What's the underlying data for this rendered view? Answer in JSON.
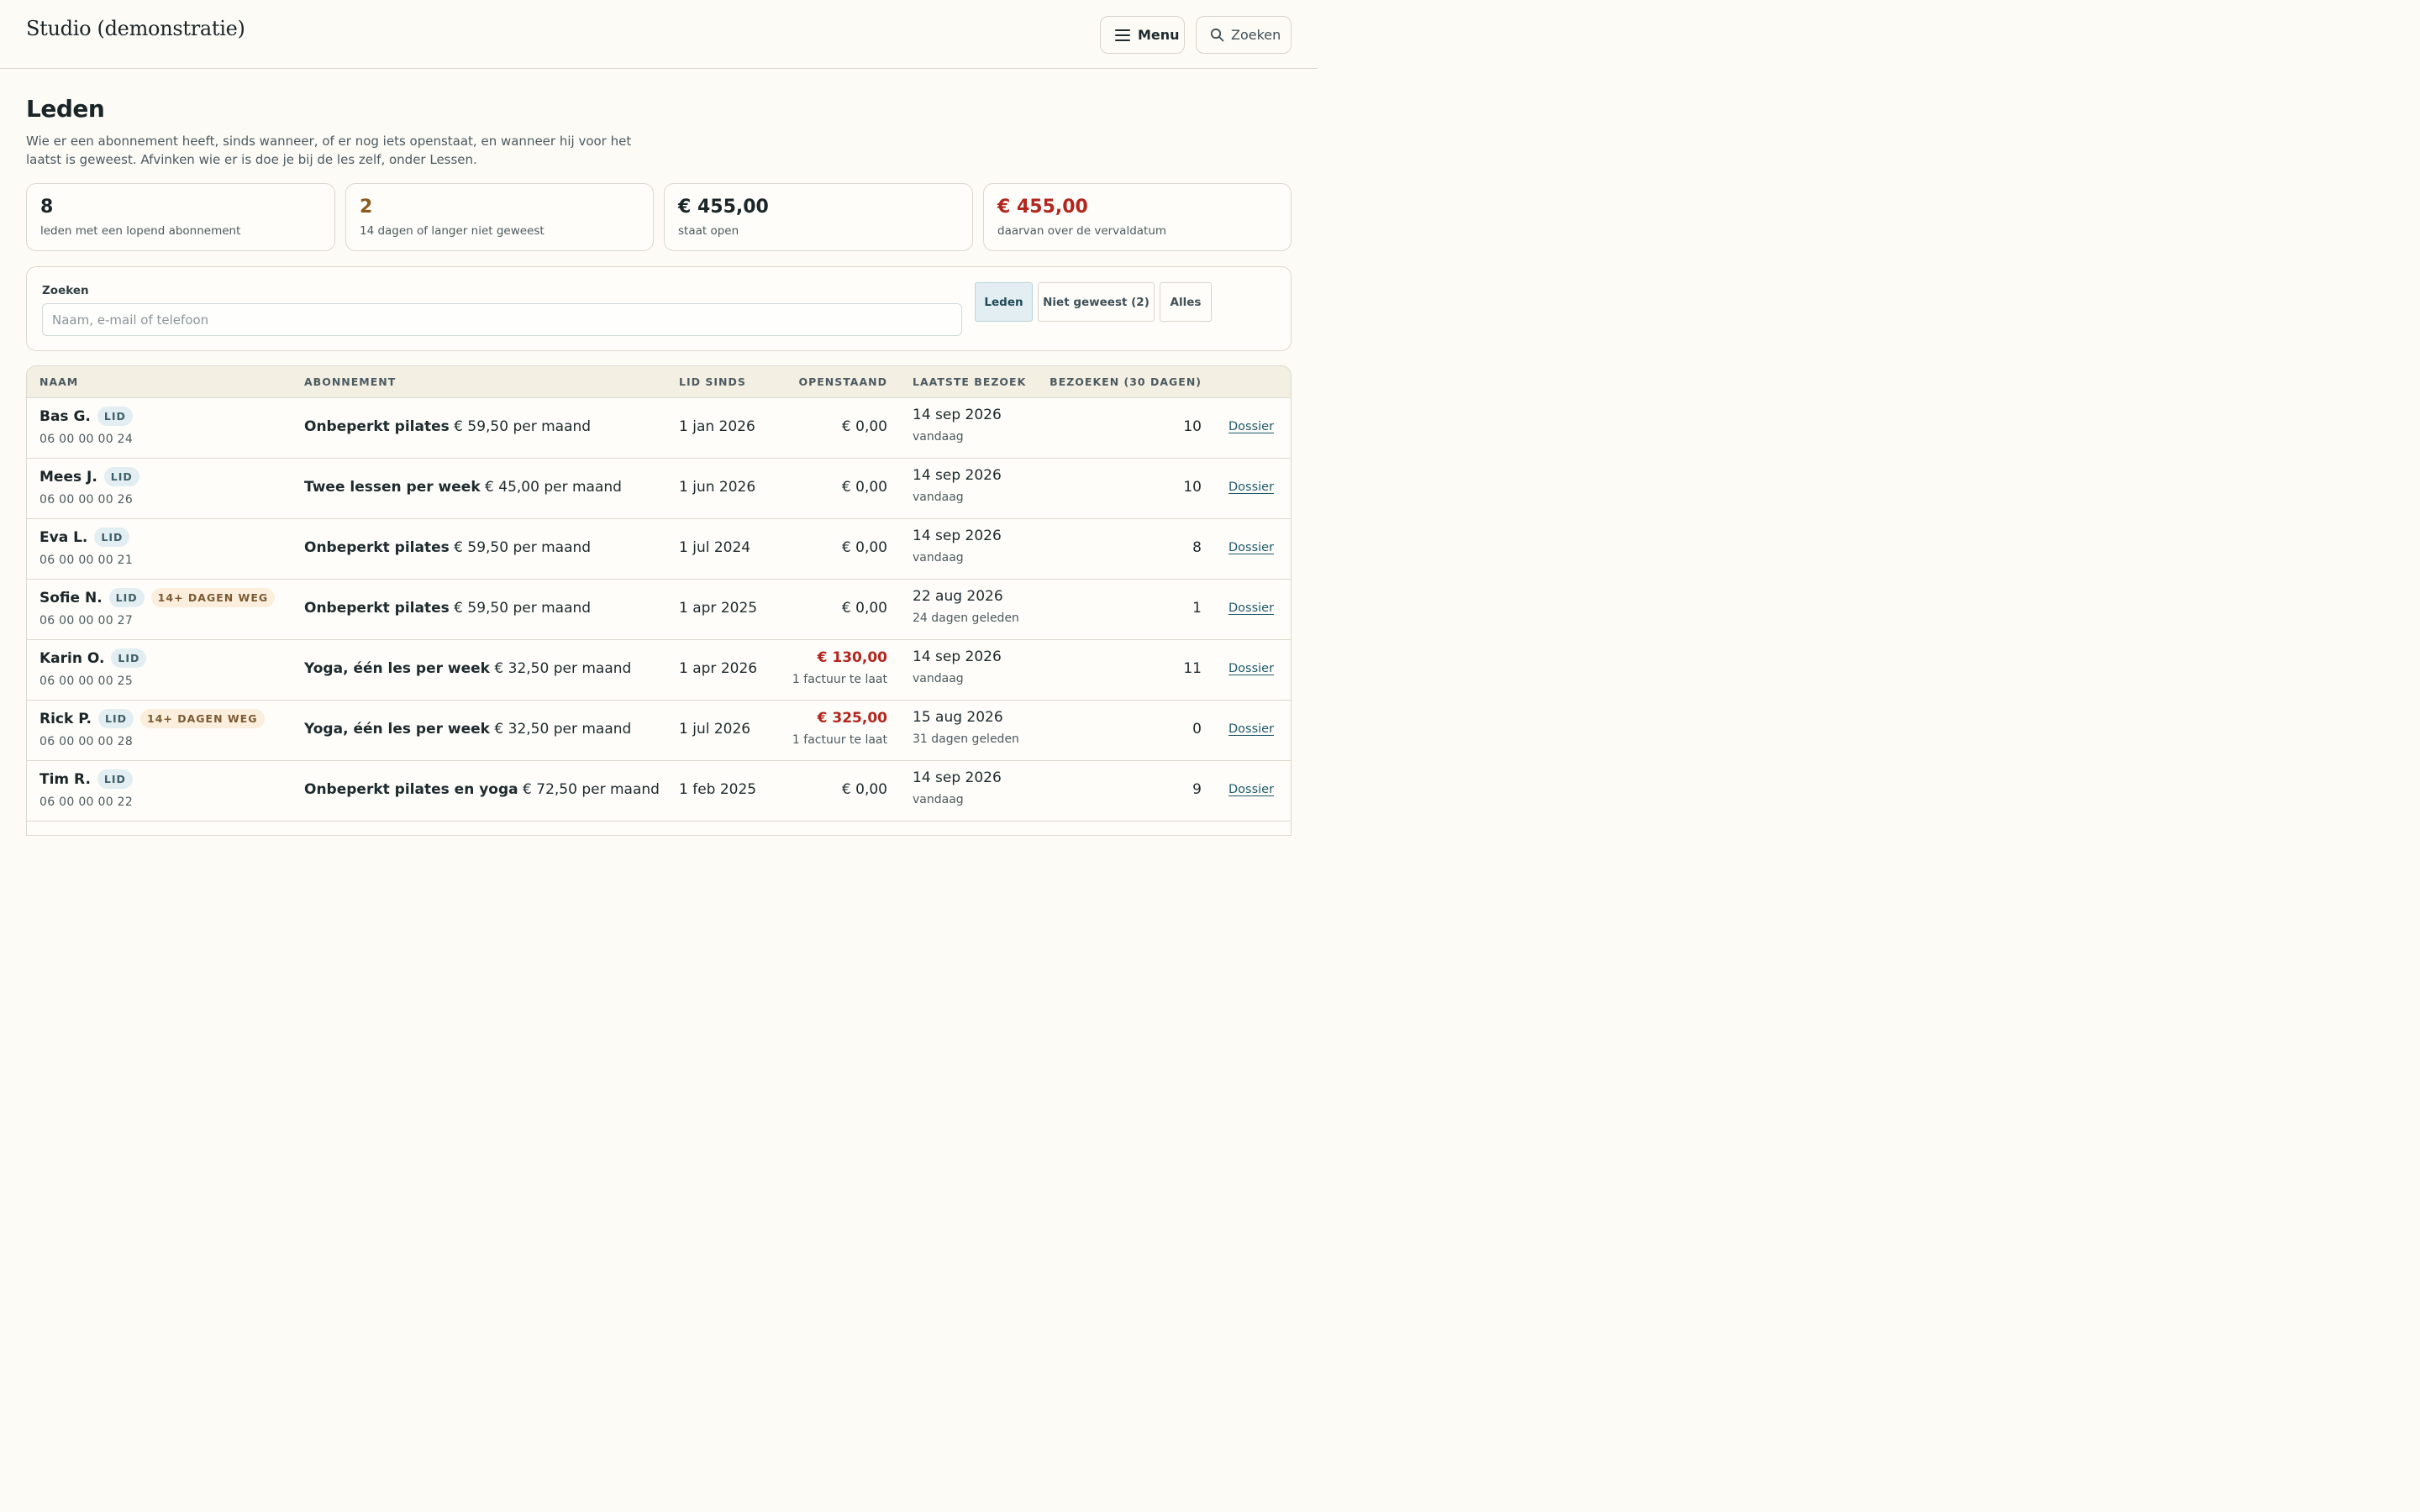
{
  "header": {
    "brand": "Studio (demonstratie)",
    "menu_label": "Menu",
    "search_label": "Zoeken"
  },
  "page": {
    "title": "Leden",
    "intro": "Wie er een abonnement heeft, sinds wanneer, of er nog iets openstaat, en wanneer hij voor het laatst is geweest. Afvinken wie er is doe je bij de les zelf, onder Lessen."
  },
  "stats": [
    {
      "value": "8",
      "label": "leden met een lopend abonnement"
    },
    {
      "value": "2",
      "label": "14 dagen of langer niet geweest"
    },
    {
      "value": "€ 455,00",
      "label": "staat open"
    },
    {
      "value": "€ 455,00",
      "label": "daarvan over de vervaldatum"
    }
  ],
  "filter": {
    "label": "Zoeken",
    "placeholder": "Naam, e-mail of telefoon",
    "value": "",
    "segments": [
      "Leden",
      "Niet geweest (2)",
      "Alles"
    ],
    "active_segment": "Leden"
  },
  "table": {
    "columns": [
      "NAAM",
      "ABONNEMENT",
      "LID SINDS",
      "OPENSTAAND",
      "LAATSTE BEZOEK",
      "BEZOEKEN (30 DAGEN)"
    ],
    "rows": [
      {
        "name": "Bas G.",
        "badges": [
          "LID"
        ],
        "phone": "06 00 00 00 24",
        "plan_name": "Onbeperkt pilates",
        "plan_price": "€ 59,50 per maand",
        "since": "1 jan 2026",
        "open": "€ 0,00",
        "open_note": "",
        "last_visit": "14 sep 2026",
        "last_visit_note": "vandaag",
        "visits": "10",
        "action": "Dossier"
      },
      {
        "name": "Mees J.",
        "badges": [
          "LID"
        ],
        "phone": "06 00 00 00 26",
        "plan_name": "Twee lessen per week",
        "plan_price": "€ 45,00 per maand",
        "since": "1 jun 2026",
        "open": "€ 0,00",
        "open_note": "",
        "last_visit": "14 sep 2026",
        "last_visit_note": "vandaag",
        "visits": "10",
        "action": "Dossier"
      },
      {
        "name": "Eva L.",
        "badges": [
          "LID"
        ],
        "phone": "06 00 00 00 21",
        "plan_name": "Onbeperkt pilates",
        "plan_price": "€ 59,50 per maand",
        "since": "1 jul 2024",
        "open": "€ 0,00",
        "open_note": "",
        "last_visit": "14 sep 2026",
        "last_visit_note": "vandaag",
        "visits": "8",
        "action": "Dossier"
      },
      {
        "name": "Sofie N.",
        "badges": [
          "LID",
          "14+ DAGEN WEG"
        ],
        "phone": "06 00 00 00 27",
        "plan_name": "Onbeperkt pilates",
        "plan_price": "€ 59,50 per maand",
        "since": "1 apr 2025",
        "open": "€ 0,00",
        "open_note": "",
        "last_visit": "22 aug 2026",
        "last_visit_note": "24 dagen geleden",
        "visits": "1",
        "action": "Dossier"
      },
      {
        "name": "Karin O.",
        "badges": [
          "LID"
        ],
        "phone": "06 00 00 00 25",
        "plan_name": "Yoga, één les per week",
        "plan_price": "€ 32,50 per maand",
        "since": "1 apr 2026",
        "open": "€ 130,00",
        "open_note": "1 factuur te laat",
        "last_visit": "14 sep 2026",
        "last_visit_note": "vandaag",
        "visits": "11",
        "action": "Dossier"
      },
      {
        "name": "Rick P.",
        "badges": [
          "LID",
          "14+ DAGEN WEG"
        ],
        "phone": "06 00 00 00 28",
        "plan_name": "Yoga, één les per week",
        "plan_price": "€ 32,50 per maand",
        "since": "1 jul 2026",
        "open": "€ 325,00",
        "open_note": "1 factuur te laat",
        "last_visit": "15 aug 2026",
        "last_visit_note": "31 dagen geleden",
        "visits": "0",
        "action": "Dossier"
      },
      {
        "name": "Tim R.",
        "badges": [
          "LID"
        ],
        "phone": "06 00 00 00 22",
        "plan_name": "Onbeperkt pilates en yoga",
        "plan_price": "€ 72,50 per maand",
        "since": "1 feb 2025",
        "open": "€ 0,00",
        "open_note": "",
        "last_visit": "14 sep 2026",
        "last_visit_note": "vandaag",
        "visits": "9",
        "action": "Dossier"
      }
    ]
  },
  "colors": {
    "background": "#fdfbf6",
    "accent": "#1f5a6a",
    "overdue": "#b3261e",
    "warning": "#8a5a1e"
  },
  "icons": {
    "menu": "hamburger-icon",
    "search": "search-icon"
  }
}
